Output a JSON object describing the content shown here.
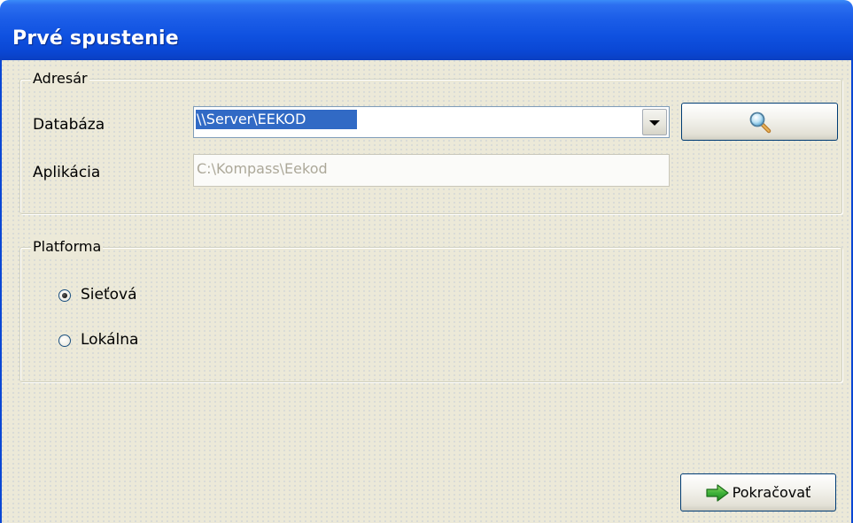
{
  "window": {
    "title": "Prvé spustenie"
  },
  "directory_group": {
    "label": "Adresár",
    "database_label": "Databáza",
    "database_value": "\\\\Server\\EEKOD",
    "application_label": "Aplikácia",
    "application_value": "C:\\Kompass\\Eekod",
    "browse_icon": "magnifier-icon"
  },
  "platform_group": {
    "label": "Platforma",
    "options": [
      {
        "label": "Sieťová",
        "selected": true
      },
      {
        "label": "Lokálna",
        "selected": false
      }
    ]
  },
  "footer": {
    "continue_label": "Pokračovať",
    "continue_icon": "green-arrow-right-icon"
  },
  "colors": {
    "titlebar": "#0a47d4",
    "selection": "#316ac5",
    "client_bg": "#ece9d8",
    "arrow_green": "#2faa2f"
  }
}
